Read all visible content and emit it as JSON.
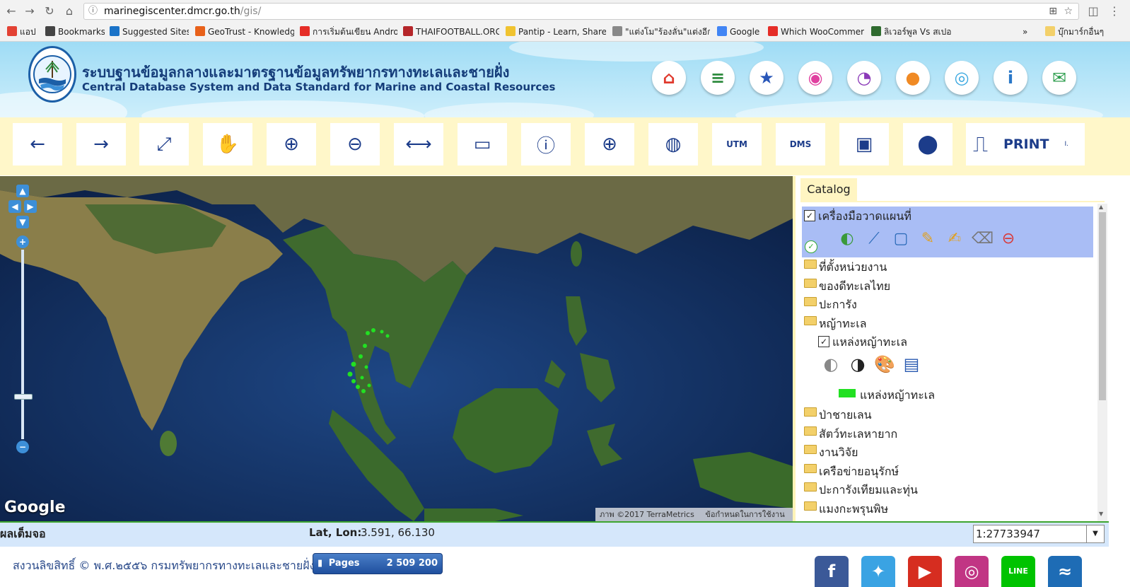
{
  "browser": {
    "url_host": "marinegiscenter.dmcr.go.th",
    "url_path": "/gis/",
    "bookmarks": [
      {
        "label": "แอป",
        "color": "#e34234"
      },
      {
        "label": "Bookmarks",
        "color": "#444444"
      },
      {
        "label": "Suggested Sites",
        "color": "#1a73c8"
      },
      {
        "label": "GeoTrust - Knowledg",
        "color": "#e8611a"
      },
      {
        "label": "การเริ่มต้นเขียน Androi",
        "color": "#e52d27"
      },
      {
        "label": "THAIFOOTBALL.ORG",
        "color": "#b5262a"
      },
      {
        "label": "Pantip - Learn, Share",
        "color": "#f0c330"
      },
      {
        "label": "\"แต่งโม\"ร้องลั่น\"แต่งอีกๆ\"",
        "color": "#888888"
      },
      {
        "label": "Google",
        "color": "#4285f4"
      },
      {
        "label": "Which WooCommerc",
        "color": "#e52d27"
      },
      {
        "label": "ลิเวอร์พูล Vs สเปอร์",
        "color": "#2f6b2f"
      }
    ],
    "bookmarks_more": "»",
    "other_bookmarks": "บุ๊กมาร์กอื่นๆ"
  },
  "header": {
    "title_th": "ระบบฐานข้อมูลกลางและมาตรฐานข้อมูลทรัพยากรทางทะเลและชายฝั่ง",
    "title_en": "Central Database System and Data Standard for Marine and Coastal Resources",
    "icons": [
      {
        "name": "home-icon",
        "glyph": "⌂",
        "color": "#e03a2e"
      },
      {
        "name": "layers-icon",
        "glyph": "≡",
        "color": "#2e8b3e"
      },
      {
        "name": "star-icon",
        "glyph": "★",
        "color": "#2856b8"
      },
      {
        "name": "pin-icon",
        "glyph": "◉",
        "color": "#e040a0"
      },
      {
        "name": "chart-icon",
        "glyph": "◔",
        "color": "#8b3ab8"
      },
      {
        "name": "user-icon",
        "glyph": "●",
        "color": "#f08a24"
      },
      {
        "name": "compass-icon",
        "glyph": "◎",
        "color": "#3aa8e0"
      },
      {
        "name": "info-icon",
        "glyph": "i",
        "color": "#2a78c8"
      },
      {
        "name": "mail-icon",
        "glyph": "✉",
        "color": "#2e9e4e"
      }
    ]
  },
  "toolbar": {
    "tools": [
      {
        "name": "back-arrow-icon",
        "glyph": "←"
      },
      {
        "name": "forward-arrow-icon",
        "glyph": "→"
      },
      {
        "name": "full-extent-icon",
        "glyph": "⤢"
      },
      {
        "name": "pan-hand-icon",
        "glyph": "✋"
      },
      {
        "name": "zoom-in-icon",
        "glyph": "⊕"
      },
      {
        "name": "zoom-out-icon",
        "glyph": "⊖"
      },
      {
        "name": "measure-distance-icon",
        "glyph": "⟷"
      },
      {
        "name": "measure-area-icon",
        "glyph": "▭"
      },
      {
        "name": "identify-info-icon",
        "glyph": "ⓘ"
      },
      {
        "name": "add-layer-globe-icon",
        "glyph": "⊕"
      },
      {
        "name": "search-globe-icon",
        "glyph": "◍"
      },
      {
        "name": "utm-convert-icon",
        "glyph": "UTM"
      },
      {
        "name": "dms-convert-icon",
        "glyph": "DMS"
      },
      {
        "name": "map-image-icon",
        "glyph": "▣"
      },
      {
        "name": "location-pin-icon",
        "glyph": "⬤"
      }
    ],
    "print_label": "PRINT",
    "print_extra": "I."
  },
  "map": {
    "google_logo": "Google",
    "attribution": "ภาพ ©2017 TerraMetrics",
    "terms": "ข้อกำหนดในการใช้งาน"
  },
  "catalog": {
    "tab_label": "Catalog",
    "draw_tools_label": "เครื่องมือวาดแผนที่",
    "draw_tools_checked": true,
    "draw_tool_icons": [
      "draw-point-icon",
      "draw-line-icon",
      "draw-polygon-icon",
      "draw-pencil-icon",
      "edit-icon",
      "eraser-icon",
      "delete-icon"
    ],
    "folders": [
      "ที่ตั้งหน่วยงาน",
      "ของดีทะเลไทย",
      "ปะการัง",
      "หญ้าทะเล"
    ],
    "sublayer_label": "แหล่งหญ้าทะเล",
    "sublayer_checked": true,
    "sublayer_tool_icons": [
      "opacity-down-icon",
      "opacity-up-icon",
      "palette-icon",
      "document-icon"
    ],
    "legend_label": "แหล่งหญ้าทะเล",
    "legend_color": "#22e022",
    "folders_after": [
      "ป่าชายเลน",
      "สัตว์ทะเลหายาก",
      "งานวิจัย",
      "เครือข่ายอนุรักษ์",
      "ปะการังเทียมและทุ่น",
      "แมงกะพรุนพิษ"
    ]
  },
  "statusbar": {
    "fullscreen_label": "ผลเต็มจอ",
    "latlon_label": "Lat, Lon:",
    "latlon_value": "3.591, 66.130",
    "scale_value": "1:27733947"
  },
  "footer": {
    "copyright": "สงวนลิขสิทธิ์ © พ.ศ.๒๕๕๖ กรมทรัพยากรทางทะเลและชายฝั่ง",
    "pages_label": "Pages",
    "pages_count": "2 509 200",
    "social": [
      {
        "name": "facebook-icon",
        "color": "#3b5998"
      },
      {
        "name": "twitter-icon",
        "color": "#3aa3e3"
      },
      {
        "name": "youtube-icon",
        "color": "#d62d20"
      },
      {
        "name": "instagram-icon",
        "color": "#c13584"
      },
      {
        "name": "line-icon",
        "color": "#00c300"
      },
      {
        "name": "dolphin-icon",
        "color": "#1e6cb5"
      }
    ]
  }
}
